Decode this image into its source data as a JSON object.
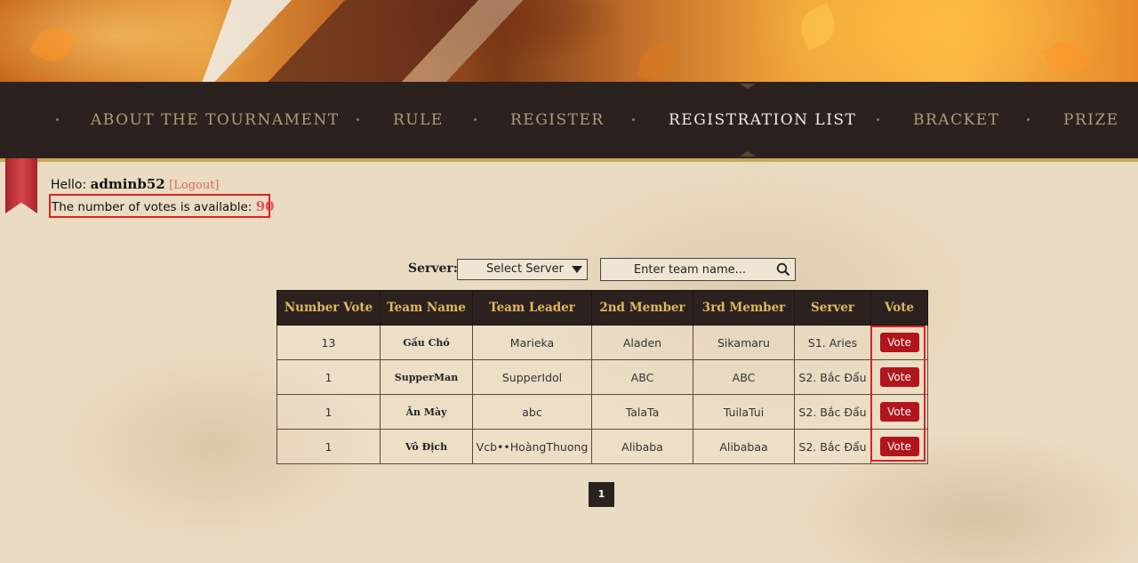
{
  "nav": {
    "items": [
      {
        "label": "ABOUT THE TOURNAMENT",
        "active": false
      },
      {
        "label": "RULE",
        "active": false
      },
      {
        "label": "REGISTER",
        "active": false
      },
      {
        "label": "REGISTRATION LIST",
        "active": true
      },
      {
        "label": "BRACKET",
        "active": false
      },
      {
        "label": "PRIZE",
        "active": false
      }
    ]
  },
  "user": {
    "hello": "Hello:",
    "username": "adminb52",
    "logout": "[Logout]",
    "votes_text": "The number of votes is available:",
    "votes_count": "90"
  },
  "filter": {
    "server_label": "Server:",
    "server_selected": "Select Server",
    "team_placeholder": "Enter team name..."
  },
  "table": {
    "headers": [
      "Number Vote",
      "Team Name",
      "Team Leader",
      "2nd Member",
      "3rd Member",
      "Server",
      "Vote"
    ],
    "vote_label": "Vote",
    "rows": [
      {
        "votes": "13",
        "team": "Gấu Chó",
        "leader": "Marieka",
        "member2": "Aladen",
        "member3": "Sikamaru",
        "server": "S1. Aries"
      },
      {
        "votes": "1",
        "team": "SupperMan",
        "leader": "SupperIdol",
        "member2": "ABC",
        "member3": "ABC",
        "server": "S2. Bắc Đẩu"
      },
      {
        "votes": "1",
        "team": "Ăn Mày",
        "leader": "abc",
        "member2": "TalaTa",
        "member3": "TuilaTui",
        "server": "S2. Bắc Đẩu"
      },
      {
        "votes": "1",
        "team": "Vô Địch",
        "leader": "Vcb••HoàngThuong",
        "member2": "Alibaba",
        "member3": "Alibabaa",
        "server": "S2. Bắc Đẩu"
      }
    ]
  },
  "pagination": {
    "current": "1"
  },
  "colors": {
    "nav_bg": "#2b2220",
    "nav_gold": "#c9a85a",
    "vote_red": "#b3151c",
    "highlight_red": "#e02020"
  }
}
